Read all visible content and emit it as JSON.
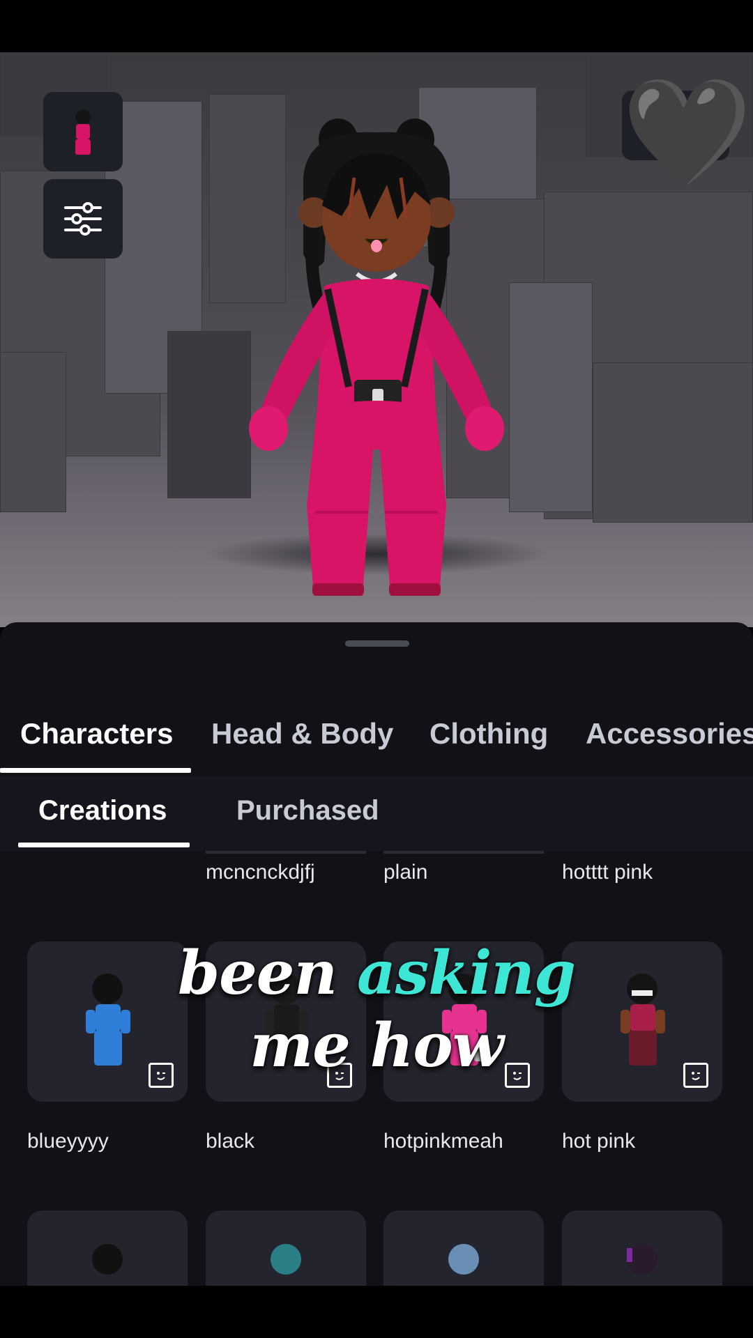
{
  "top_actions": {
    "avatar_thumbnail": "avatar-thumbnail-icon",
    "filter": "sliders-icon",
    "favorite": "black-heart-icon"
  },
  "favorite_emoji": "🖤",
  "main_tabs": [
    {
      "label": "Characters",
      "active": true
    },
    {
      "label": "Head & Body",
      "active": false
    },
    {
      "label": "Clothing",
      "active": false
    },
    {
      "label": "Accessories",
      "active": false
    }
  ],
  "sub_tabs": [
    {
      "label": "Creations",
      "active": true
    },
    {
      "label": "Purchased",
      "active": false
    }
  ],
  "characters_row1": [
    {
      "name": ""
    },
    {
      "name": "mcncnckdjfj"
    },
    {
      "name": "plain"
    },
    {
      "name": "hotttt pink"
    }
  ],
  "characters_row2": [
    {
      "name": "blueyyyy",
      "outfit_color": "#2f7fd8"
    },
    {
      "name": "black",
      "outfit_color": "#1a1a1a"
    },
    {
      "name": "hotpinkmeah",
      "outfit_color": "#e6338f"
    },
    {
      "name": "hot pink",
      "outfit_color": "#a8204a"
    }
  ],
  "caption": {
    "word1": "been",
    "word2": "asking",
    "line2": "me how",
    "accent_color": "#3ee6d6"
  },
  "colors": {
    "sheet_bg": "#111217",
    "card_bg": "#23242d",
    "avatar_outfit": "#d81466",
    "skin": "#7a3d22"
  }
}
